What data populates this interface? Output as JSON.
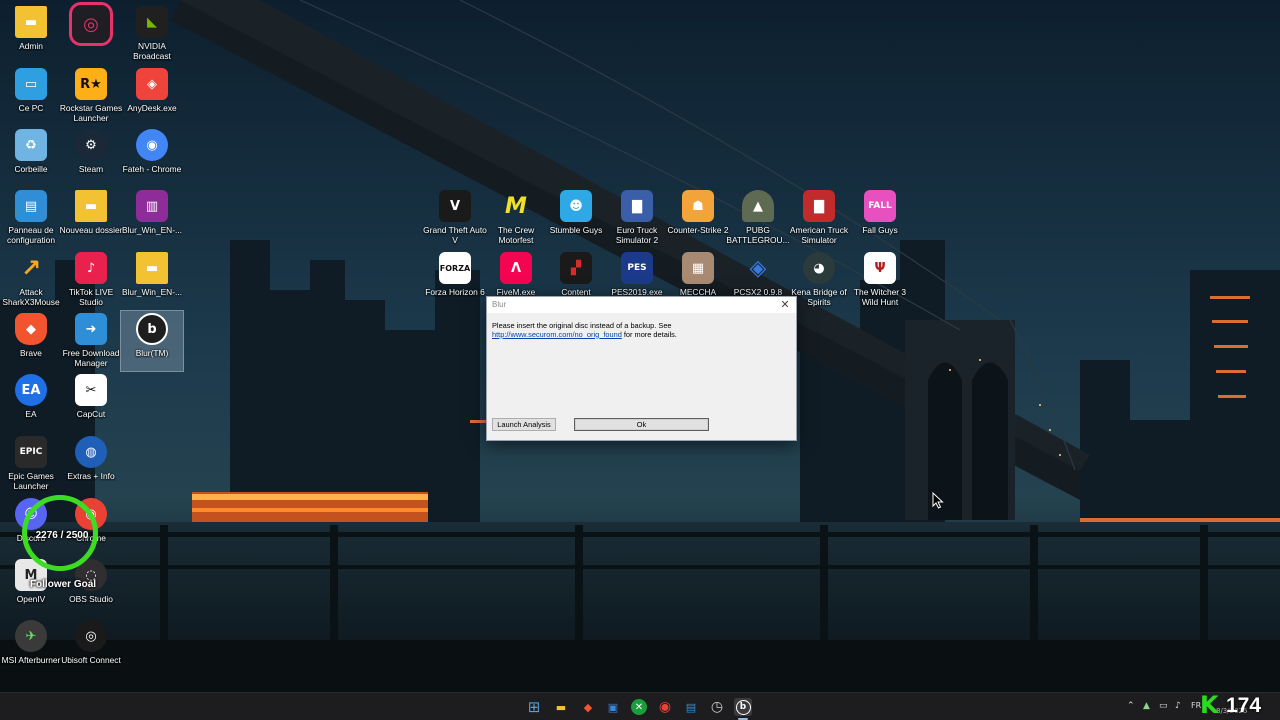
{
  "desktop_icons": [
    {
      "key": "admin",
      "label": "Admin",
      "icon": "folder-icon",
      "color": "#f2c233"
    },
    {
      "key": "ce-pc",
      "label": "Ce PC",
      "icon": "monitor-icon",
      "color": "#2e9fe0"
    },
    {
      "key": "corbeille",
      "label": "Corbeille",
      "icon": "recycle-bin-icon",
      "color": "#6fb4e2"
    },
    {
      "key": "panneau",
      "label": "Panneau de configuration",
      "icon": "control-panel-icon",
      "color": "#2f8ed6"
    },
    {
      "key": "attack-shark",
      "label": "Attack SharkX3Mouse",
      "icon": "shark-icon",
      "color": "#f5a623"
    },
    {
      "key": "brave",
      "label": "Brave",
      "icon": "brave-lion-icon",
      "color": "#f2542d"
    },
    {
      "key": "ea",
      "label": "EA",
      "icon": "ea-icon",
      "color": "#1f6fe6"
    },
    {
      "key": "epic",
      "label": "Epic Games Launcher",
      "icon": "epic-games-icon",
      "color": "#2a2a2a"
    },
    {
      "key": "discord",
      "label": "Discord",
      "icon": "discord-icon",
      "color": "#5865f2"
    },
    {
      "key": "openiv",
      "label": "OpenIV",
      "icon": "openiv-icon",
      "color": "#e8e8e8"
    },
    {
      "key": "msi",
      "label": "MSI Afterburner",
      "icon": "afterburner-icon",
      "color": "#3a3a3a"
    },
    {
      "key": "unknown-top",
      "label": "",
      "icon": "ring-app-icon",
      "color": "#e8336a"
    },
    {
      "key": "rockstar",
      "label": "Rockstar Games Launcher",
      "icon": "rockstar-icon",
      "color": "#fcaf17"
    },
    {
      "key": "steam",
      "label": "Steam",
      "icon": "steam-icon",
      "color": "#1b2838"
    },
    {
      "key": "nouveau",
      "label": "Nouveau dossier",
      "icon": "folder-icon",
      "color": "#f2c233"
    },
    {
      "key": "tiktok",
      "label": "TikTok LIVE Studio",
      "icon": "tiktok-icon",
      "color": "#111111"
    },
    {
      "key": "fdm",
      "label": "Free Download Manager",
      "icon": "download-manager-icon",
      "color": "#2e8fd8"
    },
    {
      "key": "capcut",
      "label": "CapCut",
      "icon": "capcut-icon",
      "color": "#ffffff"
    },
    {
      "key": "extras",
      "label": "Extras + Info",
      "icon": "globe-icon",
      "color": "#1f5fb8"
    },
    {
      "key": "chrome2",
      "label": "Chrome",
      "icon": "chrome-icon",
      "color": "#e94235"
    },
    {
      "key": "obs",
      "label": "OBS Studio",
      "icon": "obs-icon",
      "color": "#302e31"
    },
    {
      "key": "ubisoft",
      "label": "Ubisoft Connect",
      "icon": "ubisoft-icon",
      "color": "#1a1a1a"
    },
    {
      "key": "nvidia",
      "label": "NVIDIA Broadcast",
      "icon": "nvidia-icon",
      "color": "#76b900"
    },
    {
      "key": "anydesk",
      "label": "AnyDesk.exe",
      "icon": "anydesk-icon",
      "color": "#ef443b"
    },
    {
      "key": "fateh",
      "label": "Fateh - Chrome",
      "icon": "chrome-icon",
      "color": "#4285f4"
    },
    {
      "key": "blur-win1",
      "label": "Blur_Win_EN-...",
      "icon": "winrar-icon",
      "color": "#8e2d9a"
    },
    {
      "key": "blur-win2",
      "label": "Blur_Win_EN-...",
      "icon": "folder-icon",
      "color": "#f2c233"
    },
    {
      "key": "blur-tm",
      "label": "Blur(TM)",
      "icon": "blur-icon",
      "color": "#1e1e1e"
    },
    {
      "key": "gta5",
      "label": "Grand Theft Auto V",
      "icon": "gta-icon",
      "color": "#1a1a1a"
    },
    {
      "key": "crew",
      "label": "The Crew Motorfest",
      "icon": "crew-icon",
      "color": "#f0e028"
    },
    {
      "key": "stumble",
      "label": "Stumble Guys",
      "icon": "stumble-icon",
      "color": "#2fa8e6"
    },
    {
      "key": "ets2",
      "label": "Euro Truck Simulator 2",
      "icon": "truck-icon",
      "color": "#3a5ea8"
    },
    {
      "key": "cs2",
      "label": "Counter-Strike 2",
      "icon": "cs2-icon",
      "color": "#f2a33a"
    },
    {
      "key": "pubg",
      "label": "PUBG BATTLEGROU...",
      "icon": "pubg-icon",
      "color": "#5e6a52"
    },
    {
      "key": "ats",
      "label": "American Truck Simulator",
      "icon": "truck-icon",
      "color": "#c22b2b"
    },
    {
      "key": "fallguys",
      "label": "Fall Guys",
      "icon": "fallguys-icon",
      "color": "#e84fbf"
    },
    {
      "key": "forza",
      "label": "Forza Horizon 6",
      "icon": "forza-icon",
      "color": "#ffffff"
    },
    {
      "key": "fivem",
      "label": "FiveM.exe",
      "icon": "fivem-icon",
      "color": "#f40552"
    },
    {
      "key": "content",
      "label": "Content",
      "icon": "content-icon",
      "color": "#d92b2b"
    },
    {
      "key": "pes",
      "label": "PES2019.exe",
      "icon": "pes-icon",
      "color": "#1c3a8a"
    },
    {
      "key": "meccha",
      "label": "MECCHA",
      "icon": "meccha-icon",
      "color": "#a88a72"
    },
    {
      "key": "pcsx2",
      "label": "PCSX2 0.9.8",
      "icon": "pcsx2-icon",
      "color": "#1a5ab8"
    },
    {
      "key": "kena",
      "label": "Kena Bridge of Spirits",
      "icon": "kena-icon",
      "color": "#2b3a3a"
    },
    {
      "key": "witcher",
      "label": "The Witcher 3 Wild Hunt",
      "icon": "witcher-icon",
      "color": "#ffffff"
    }
  ],
  "follower_goal": {
    "count": "2276 / 2500",
    "label": "Follower Goal",
    "progress": 0.9104,
    "ring_color": "#3ddc24"
  },
  "dialog": {
    "title": "Blur",
    "message_line1": "Please insert the original disc instead of a backup. See",
    "link": "http://www.securom.com/no_orig_found",
    "message_suffix": " for more details.",
    "buttons": {
      "launch": "Launch Analysis",
      "ok": "Ok"
    },
    "close_symbol": "✕"
  },
  "taskbar": {
    "apps": [
      {
        "key": "start",
        "icon": "windows-start-icon",
        "glyph": "⊞",
        "color": "#4aa3f0"
      },
      {
        "key": "explorer",
        "icon": "file-explorer-icon",
        "glyph": "▬",
        "color": "#f2c233"
      },
      {
        "key": "brave",
        "icon": "brave-lion-icon",
        "glyph": "◆",
        "color": "#f2542d"
      },
      {
        "key": "store",
        "icon": "store-icon",
        "glyph": "▣",
        "color": "#3a86d8"
      },
      {
        "key": "xbox",
        "icon": "xbox-icon",
        "glyph": "✕",
        "color": "#1a9e3a"
      },
      {
        "key": "chrome",
        "icon": "chrome-icon",
        "glyph": "◉",
        "color": "#e94235"
      },
      {
        "key": "control",
        "icon": "control-panel-icon",
        "glyph": "▤",
        "color": "#2f8ed6"
      },
      {
        "key": "clock-app",
        "icon": "timer-icon",
        "glyph": "◷",
        "color": "#5a5a5a"
      },
      {
        "key": "blur",
        "icon": "blur-icon",
        "glyph": "b",
        "color": "#1e1e1e"
      }
    ],
    "tray": {
      "lang": "FR",
      "date_partial": "8/3/2025"
    },
    "kick_badge": "K",
    "kick_count": "174",
    "accent": "#2bdc1e"
  }
}
